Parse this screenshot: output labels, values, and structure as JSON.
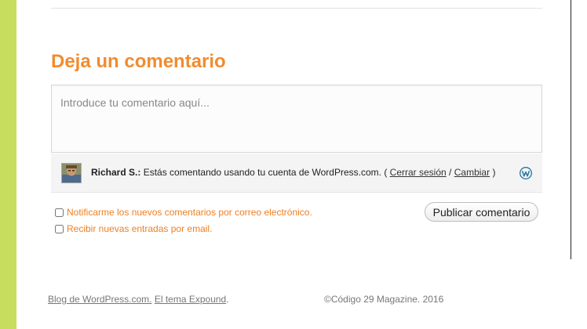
{
  "comment_form": {
    "heading": "Deja un comentario",
    "textarea_placeholder": "Introduce tu comentario aquí...",
    "identity": {
      "name": "Richard S.:",
      "message": "Estás comentando usando tu cuenta de WordPress.com.",
      "paren_open": "(",
      "logout_label": "Cerrar sesión",
      "separator": "/",
      "change_label": "Cambiar",
      "paren_close": ")",
      "service_icon": "wordpress-icon"
    },
    "options": [
      {
        "label": "Notificarme los nuevos comentarios por correo electrónico.",
        "checked": false
      },
      {
        "label": "Recibir nuevas entradas por email.",
        "checked": false
      }
    ],
    "submit_label": "Publicar comentario"
  },
  "footer": {
    "blog_link": "Blog de WordPress.com.",
    "theme_link": "El tema Expound",
    "theme_suffix": ".",
    "copyright": "©Código 29 Magazine. 2016"
  },
  "colors": {
    "accent": "#f18c2f",
    "sidebar_green": "#c6dd5e",
    "wordpress_blue": "#21759b"
  }
}
